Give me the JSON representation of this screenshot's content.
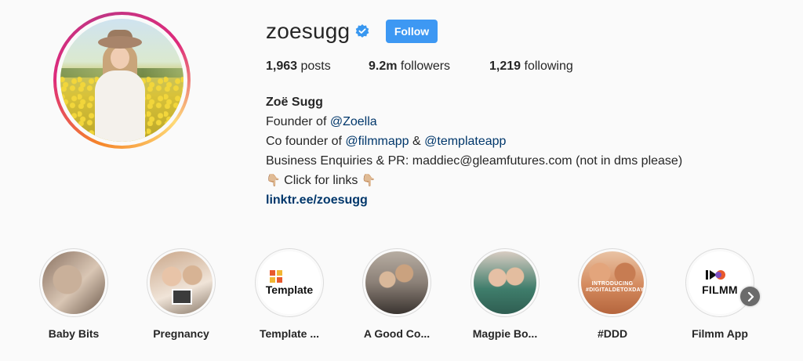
{
  "profile": {
    "username": "zoesugg",
    "follow_label": "Follow",
    "verified_color": "#3897f0",
    "stats": {
      "posts_count": "1,963",
      "posts_label": "posts",
      "followers_count": "9.2m",
      "followers_label": "followers",
      "following_count": "1,219",
      "following_label": "following"
    },
    "bio": {
      "name": "Zoë Sugg",
      "line1_prefix": "Founder of ",
      "line1_mention": "@Zoella",
      "line2_prefix": "Co founder of ",
      "line2_mention1": "@filmmapp",
      "line2_sep": " & ",
      "line2_mention2": "@templateapp",
      "line3": "Business Enquiries & PR: maddiec@gleamfutures.com (not in dms please)",
      "line4_text": " Click for links ",
      "pointer_emoji": "👇🏼",
      "link": "linktr.ee/zoesugg"
    }
  },
  "highlights": [
    {
      "label": "Baby Bits"
    },
    {
      "label": "Pregnancy"
    },
    {
      "label": "Template ...",
      "logo_text": "Template"
    },
    {
      "label": "A Good Co..."
    },
    {
      "label": "Magpie Bo..."
    },
    {
      "label": "#DDD",
      "overlay_text": "INTRODUCING #DIGITALDETOXDAY"
    },
    {
      "label": "Filmm App",
      "logo_text": "FILMM"
    }
  ],
  "colors": {
    "accent": "#3d98f3",
    "link": "#00376b",
    "text": "#262626",
    "background": "#fafafa"
  }
}
